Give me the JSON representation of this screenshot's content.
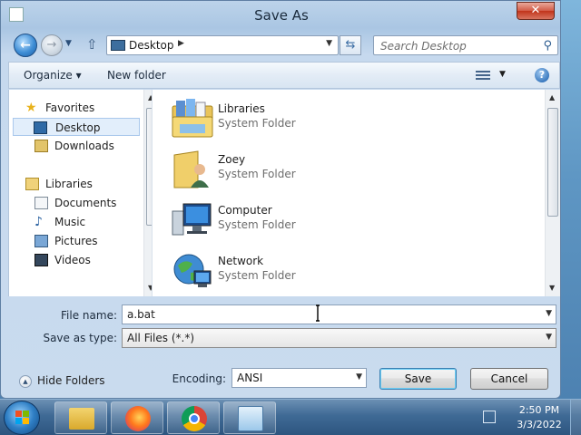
{
  "dialog": {
    "title": "Save As",
    "close_label": "✕"
  },
  "nav": {
    "back_icon": "arrow-left-icon",
    "address_path": "Desktop",
    "search_placeholder": "Search Desktop"
  },
  "toolbar": {
    "organize_label": "Organize ▾",
    "new_folder_label": "New folder",
    "help_label": "?"
  },
  "sidebar": {
    "items": [
      {
        "label": "Favorites",
        "icon": "star-icon"
      },
      {
        "label": "Desktop",
        "icon": "desktop-icon",
        "selected": true
      },
      {
        "label": "Downloads",
        "icon": "downloads-icon"
      },
      {
        "label": "Libraries",
        "icon": "libraries-icon"
      },
      {
        "label": "Documents",
        "icon": "documents-icon"
      },
      {
        "label": "Music",
        "icon": "music-icon"
      },
      {
        "label": "Pictures",
        "icon": "pictures-icon"
      },
      {
        "label": "Videos",
        "icon": "videos-icon"
      }
    ]
  },
  "files": [
    {
      "name": "Libraries",
      "type": "System Folder",
      "icon": "libraries-folder-icon"
    },
    {
      "name": "Zoey",
      "type": "System Folder",
      "icon": "user-folder-icon"
    },
    {
      "name": "Computer",
      "type": "System Folder",
      "icon": "computer-icon"
    },
    {
      "name": "Network",
      "type": "System Folder",
      "icon": "network-icon"
    }
  ],
  "form": {
    "filename_label": "File name:",
    "filename_value": "a.bat",
    "savetype_label": "Save as type:",
    "savetype_value": "All Files  (*.*)",
    "encoding_label": "Encoding:",
    "encoding_value": "ANSI"
  },
  "footer": {
    "hide_folders_label": "Hide Folders",
    "save_label": "Save",
    "cancel_label": "Cancel"
  },
  "taskbar": {
    "time": "2:50 PM",
    "date": "3/3/2022",
    "apps": [
      "explorer-icon",
      "firefox-icon",
      "chrome-icon",
      "notepad-icon"
    ]
  }
}
